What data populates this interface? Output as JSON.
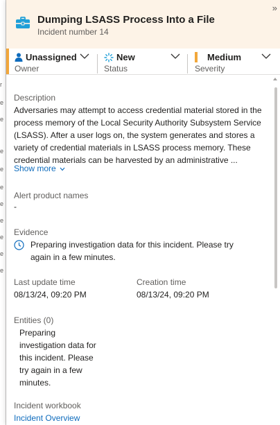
{
  "header": {
    "title": "Dumping LSASS Process Into a File",
    "incident_number": "Incident number 14",
    "collapse_glyph": "»",
    "icon": "briefcase-icon",
    "background_color": "#fdf3e7",
    "icon_color": "#1f9fd8"
  },
  "status_bar": {
    "owner": {
      "value": "Unassigned",
      "label": "Owner",
      "icon": "person-icon"
    },
    "status": {
      "value": "New",
      "label": "Status",
      "icon": "spinner-icon"
    },
    "severity": {
      "value": "Medium",
      "label": "Severity",
      "color": "#f2a73b"
    }
  },
  "description": {
    "label": "Description",
    "lines": [
      "Adversaries may attempt to access credential material stored in the",
      "process memory of the Local Security Authority Subsystem Service",
      "(LSASS). After a user logs on, the system generates and stores a",
      "variety of credential materials in LSASS process memory. These",
      "credential materials can be harvested by an administrative ..."
    ],
    "show_more": "Show more"
  },
  "alert_products": {
    "label": "Alert product names",
    "value": "-"
  },
  "evidence": {
    "label": "Evidence",
    "message_lines": [
      "Preparing investigation data for this incident. Please try",
      "again in a few minutes."
    ],
    "icon": "clock-icon"
  },
  "times": {
    "last_update_label": "Last update time",
    "last_update_value": "08/13/24, 09:20 PM",
    "creation_label": "Creation time",
    "creation_value": "08/13/24, 09:20 PM"
  },
  "entities": {
    "label": "Entities (0)",
    "message_lines": [
      "Preparing",
      "investigation data for",
      "this incident. Please",
      "try again in a few",
      "minutes."
    ]
  },
  "workbook": {
    "label": "Incident workbook",
    "link": "Incident Overview"
  },
  "colors": {
    "link": "#0f6cbd",
    "accent": "#f2a73b"
  }
}
